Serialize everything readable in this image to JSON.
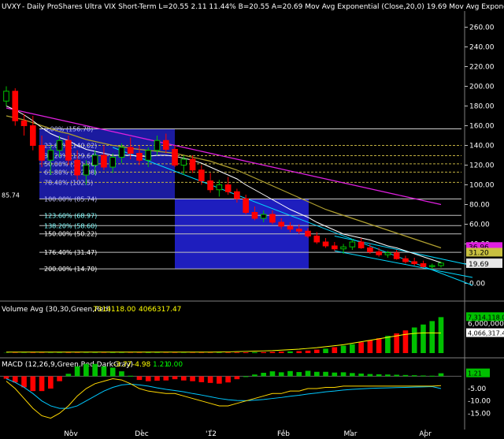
{
  "header": {
    "symbol": "UVXY",
    "text": "- Daily  ProShares Ultra VIX Short-Term  L=20.55  2.11  11.44%  B=20.55  A=20.69  Mov Avg Exponential (Close,20,0)   19.69  Mov Avg Exponential (Close,50,0 ..."
  },
  "colors": {
    "background": "#000000",
    "up": "#00c000",
    "down": "#ff0000",
    "ema20": "#ffffff",
    "ema50": "#b0a030",
    "long_ma": "#e020e0",
    "channel": "#00d8ff",
    "fib_box": "#1c1ca8",
    "fib_box2": "#2020c8",
    "macd_line": "#ffd800",
    "signal_line": "#00c8ff"
  },
  "chart_data": [
    {
      "type": "candlestick",
      "title": "UVXY - Daily ProShares Ultra VIX Short-Term",
      "ylim": [
        -10,
        270
      ],
      "yticks": [
        "260.00",
        "240.00",
        "220.00",
        "200.00",
        "180.00",
        "160.00",
        "140.00",
        "120.00",
        "100.00",
        "80.00",
        "60.00",
        "40.00",
        "20.00",
        "0.00"
      ],
      "xlabels": [
        "Nov",
        "Dec",
        "'12",
        "Feb",
        "Mar",
        "Apr"
      ],
      "last_price_labels": [
        {
          "text": "85.74",
          "side": "left"
        },
        {
          "text": "36.96",
          "bg": "#e020e0"
        },
        {
          "text": "31.20",
          "bg": "#c8c040"
        },
        {
          "text": "20.55",
          "bg": "#c8c8c8"
        },
        {
          "text": "19.69",
          "bg": "#e8e8e8"
        }
      ],
      "fib_set_1": [
        {
          "label": "0.00% (156.78)",
          "value": 156.78
        },
        {
          "label": "23.60% (140.02)",
          "value": 140.02
        },
        {
          "label": "38.20% (129.64)",
          "value": 129.64
        },
        {
          "label": "50.00% (121.26)",
          "value": 121.26
        },
        {
          "label": "61.80% (112.88)",
          "value": 112.88
        },
        {
          "label": "78.40% (102.5)",
          "value": 102.5
        },
        {
          "label": "100.00% (85.74)",
          "value": 85.74
        }
      ],
      "fib_set_2": [
        {
          "label": "123.60% (68.97)",
          "value": 68.97
        },
        {
          "label": "138.20% (58.60)",
          "value": 58.6
        },
        {
          "label": "150.00% (50.22)",
          "value": 50.22
        },
        {
          "label": "176.40% (31.47)",
          "value": 31.47
        },
        {
          "label": "200.00% (14.70)",
          "value": 14.7
        }
      ],
      "series": [
        {
          "name": "Mov Avg Exponential (Close,20,0)"
        },
        {
          "name": "Mov Avg Exponential (Close,50,0 ..."
        }
      ],
      "ohlc": [
        [
          185,
          200,
          180,
          195
        ],
        [
          195,
          198,
          160,
          165
        ],
        [
          165,
          172,
          150,
          160
        ],
        [
          160,
          170,
          135,
          140
        ],
        [
          140,
          150,
          118,
          125
        ],
        [
          125,
          140,
          110,
          135
        ],
        [
          135,
          150,
          128,
          145
        ],
        [
          145,
          150,
          120,
          125
        ],
        [
          125,
          135,
          105,
          110
        ],
        [
          110,
          125,
          100,
          120
        ],
        [
          120,
          135,
          110,
          130
        ],
        [
          130,
          140,
          115,
          118
        ],
        [
          118,
          132,
          112,
          128
        ],
        [
          128,
          142,
          122,
          138
        ],
        [
          138,
          148,
          126,
          132
        ],
        [
          132,
          140,
          120,
          125
        ],
        [
          125,
          138,
          118,
          135
        ],
        [
          135,
          150,
          130,
          145
        ],
        [
          145,
          152,
          132,
          136
        ],
        [
          136,
          140,
          118,
          120
        ],
        [
          120,
          130,
          110,
          126
        ],
        [
          126,
          130,
          112,
          115
        ],
        [
          115,
          120,
          100,
          104
        ],
        [
          104,
          112,
          92,
          95
        ],
        [
          95,
          105,
          88,
          100
        ],
        [
          100,
          108,
          90,
          93
        ],
        [
          93,
          96,
          82,
          86
        ],
        [
          86,
          90,
          70,
          72
        ],
        [
          72,
          78,
          64,
          66
        ],
        [
          66,
          74,
          62,
          70
        ],
        [
          70,
          74,
          60,
          62
        ],
        [
          62,
          66,
          55,
          58
        ],
        [
          58,
          62,
          52,
          55
        ],
        [
          55,
          60,
          50,
          53
        ],
        [
          53,
          56,
          46,
          48
        ],
        [
          48,
          52,
          40,
          42
        ],
        [
          42,
          46,
          36,
          38
        ],
        [
          38,
          42,
          33,
          35
        ],
        [
          35,
          40,
          30,
          37
        ],
        [
          37,
          45,
          34,
          42
        ],
        [
          42,
          46,
          35,
          36
        ],
        [
          36,
          40,
          30,
          32
        ],
        [
          32,
          36,
          27,
          29
        ],
        [
          29,
          33,
          26,
          31
        ],
        [
          31,
          34,
          24,
          25
        ],
        [
          25,
          28,
          20,
          22
        ],
        [
          22,
          26,
          18,
          20
        ],
        [
          20,
          23,
          16,
          17
        ],
        [
          17,
          20,
          14,
          18
        ],
        [
          18,
          22,
          16,
          20.55
        ]
      ],
      "ema20": [
        180,
        176,
        171,
        165,
        158,
        152,
        148,
        145,
        140,
        136,
        134,
        132,
        130,
        130,
        130,
        129,
        129,
        130,
        130,
        129,
        127,
        125,
        122,
        118,
        114,
        110,
        106,
        100,
        95,
        90,
        85,
        80,
        75,
        71,
        67,
        62,
        58,
        54,
        50,
        48,
        46,
        44,
        41,
        38,
        36,
        33,
        30,
        27,
        24,
        21
      ],
      "ema50": [
        170,
        168,
        166,
        163,
        160,
        157,
        154,
        152,
        149,
        146,
        144,
        142,
        140,
        139,
        137,
        136,
        135,
        134,
        133,
        132,
        130,
        128,
        126,
        124,
        121,
        118,
        115,
        111,
        107,
        103,
        99,
        95,
        91,
        87,
        83,
        79,
        75,
        72,
        69,
        66,
        63,
        60,
        57,
        54,
        51,
        48,
        45,
        42,
        39,
        36
      ],
      "long_ma": [
        178,
        176,
        174,
        172,
        170,
        168,
        166,
        164,
        162,
        160,
        158,
        156,
        154,
        152,
        150,
        148,
        146,
        144,
        142,
        140,
        138,
        136,
        134,
        132,
        130,
        128,
        126,
        124,
        122,
        120,
        118,
        116,
        114,
        112,
        110,
        108,
        106,
        104,
        102,
        100,
        98,
        96,
        94,
        92,
        90,
        88,
        86,
        84,
        82,
        80
      ]
    },
    {
      "type": "bar",
      "title": "Volume Avg (30,30,Green,Red)",
      "values_text": [
        "7314118.00",
        "4066317.47"
      ],
      "ylim": [
        0,
        8000000
      ],
      "yticks": [
        "6,000,000.00"
      ],
      "last_price_labels": [
        {
          "text": "7,314,118.00",
          "bg": "#00c000"
        },
        {
          "text": "4,066,317.47",
          "bg": "#ffffff"
        }
      ],
      "volume_scale": 1000000,
      "volume": [
        0.05,
        0.06,
        0.05,
        0.07,
        0.06,
        0.05,
        0.06,
        0.07,
        0.06,
        0.05,
        0.06,
        0.05,
        0.07,
        0.06,
        0.05,
        0.06,
        0.07,
        0.06,
        0.05,
        0.06,
        0.05,
        0.06,
        0.07,
        0.06,
        0.08,
        0.1,
        0.12,
        0.15,
        0.18,
        0.2,
        0.25,
        0.3,
        0.35,
        0.4,
        0.5,
        0.7,
        0.9,
        1.2,
        1.5,
        1.8,
        2.2,
        2.6,
        3.0,
        3.5,
        4.0,
        4.6,
        5.2,
        5.8,
        6.5,
        7.3
      ],
      "volume_up": [
        1,
        0,
        1,
        0,
        0,
        1,
        1,
        0,
        0,
        1,
        1,
        0,
        1,
        1,
        0,
        0,
        1,
        1,
        0,
        0,
        1,
        0,
        0,
        0,
        1,
        0,
        0,
        0,
        1,
        0,
        0,
        0,
        1,
        0,
        0,
        0,
        1,
        0,
        1,
        1,
        0,
        0,
        0,
        1,
        0,
        0,
        1,
        1,
        1,
        1
      ],
      "avg": [
        0.2,
        0.2,
        0.2,
        0.2,
        0.2,
        0.2,
        0.2,
        0.2,
        0.2,
        0.2,
        0.2,
        0.2,
        0.2,
        0.2,
        0.2,
        0.2,
        0.2,
        0.2,
        0.2,
        0.2,
        0.2,
        0.2,
        0.2,
        0.2,
        0.22,
        0.25,
        0.3,
        0.35,
        0.4,
        0.45,
        0.5,
        0.6,
        0.7,
        0.8,
        0.95,
        1.1,
        1.3,
        1.5,
        1.7,
        2.0,
        2.3,
        2.6,
        2.9,
        3.2,
        3.5,
        3.8,
        4.0,
        4.1,
        4.1,
        4.07
      ]
    },
    {
      "type": "bar",
      "title": "MACD (12,26,9,Green,Red,DarkGray)",
      "values_text": [
        "-3.77",
        "-4.98",
        "1.21",
        "0.00"
      ],
      "ylim": [
        -20,
        3
      ],
      "yticks": [
        "-5.00",
        "-10.00",
        "-15.00"
      ],
      "last_price_labels": [
        {
          "text": "1.21",
          "bg": "#00c000"
        }
      ],
      "macd": [
        -2,
        -5,
        -9,
        -13,
        -16,
        -17,
        -15,
        -12,
        -8,
        -5,
        -3,
        -2,
        -1,
        -1.5,
        -3,
        -5,
        -6,
        -6.5,
        -7,
        -7,
        -8,
        -9,
        -10,
        -11,
        -12,
        -12,
        -11,
        -10,
        -9,
        -8,
        -7,
        -7,
        -6,
        -6,
        -5,
        -5,
        -4.5,
        -4.5,
        -4,
        -4,
        -4,
        -4,
        -4,
        -4,
        -4,
        -4,
        -4,
        -4,
        -4,
        -3.77
      ],
      "signal": [
        -1,
        -2.5,
        -4.5,
        -7,
        -10,
        -12,
        -13,
        -13,
        -12,
        -10,
        -8,
        -6,
        -4.5,
        -3.5,
        -3.2,
        -3.5,
        -4,
        -4.7,
        -5.3,
        -5.8,
        -6.3,
        -7,
        -7.6,
        -8.3,
        -9,
        -9.5,
        -9.8,
        -9.9,
        -9.7,
        -9.4,
        -9,
        -8.6,
        -8.1,
        -7.7,
        -7.2,
        -6.8,
        -6.3,
        -6,
        -5.6,
        -5.3,
        -5.1,
        -4.9,
        -4.8,
        -4.7,
        -4.6,
        -4.5,
        -4.4,
        -4.3,
        -4.2,
        -4.98
      ],
      "hist": [
        -1,
        -2.5,
        -4.5,
        -6,
        -6,
        -5,
        -2,
        1,
        4,
        5,
        5,
        4,
        3.5,
        2,
        0.2,
        -1.5,
        -2,
        -1.8,
        -1.7,
        -1.2,
        -1.7,
        -2,
        -2.4,
        -2.7,
        -3,
        -2.5,
        -1.2,
        0,
        0.7,
        1.4,
        2,
        1.6,
        2.1,
        1.7,
        2.2,
        1.8,
        1.8,
        1.5,
        1.6,
        1.3,
        1.1,
        0.9,
        0.8,
        0.7,
        0.6,
        0.5,
        0.4,
        0.3,
        0.2,
        1.21
      ]
    }
  ]
}
